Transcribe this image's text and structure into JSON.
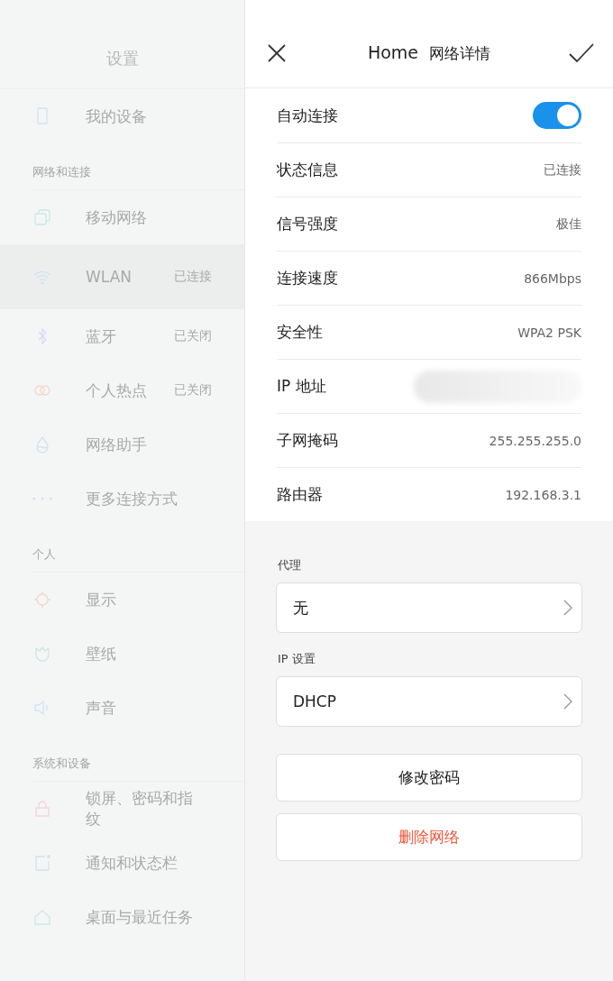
{
  "sidebar": {
    "title": "设置",
    "sections": [
      {
        "items": [
          {
            "label": "我的设备",
            "selected": false
          }
        ]
      },
      {
        "heading": "网络和连接",
        "items": [
          {
            "label": "移动网络",
            "selected": false
          },
          {
            "label": "WLAN",
            "status": "已连接",
            "selected": true
          },
          {
            "label": "蓝牙",
            "status": "已关闭",
            "selected": false
          },
          {
            "label": "个人热点",
            "status": "已关闭",
            "selected": false
          },
          {
            "label": "网络助手",
            "selected": false
          },
          {
            "label": "更多连接方式",
            "selected": false
          }
        ]
      },
      {
        "heading": "个人",
        "items": [
          {
            "label": "显示",
            "selected": false
          },
          {
            "label": "壁纸",
            "selected": false
          },
          {
            "label": "声音",
            "selected": false
          }
        ]
      },
      {
        "heading": "系统和设备",
        "items": [
          {
            "label": "锁屏、密码和指纹",
            "selected": false
          },
          {
            "label": "通知和状态栏",
            "selected": false
          },
          {
            "label": "桌面与最近任务",
            "selected": false
          }
        ]
      }
    ]
  },
  "detail": {
    "title": "Home",
    "subtitle": "网络详情",
    "rows": [
      {
        "kind": "toggle",
        "label": "自动连接",
        "on": true
      },
      {
        "kind": "value",
        "label": "状态信息",
        "value": "已连接"
      },
      {
        "kind": "value",
        "label": "信号强度",
        "value": "极佳"
      },
      {
        "kind": "value",
        "label": "连接速度",
        "value": "866Mbps"
      },
      {
        "kind": "value",
        "label": "安全性",
        "value": "WPA2 PSK"
      },
      {
        "kind": "hidden",
        "label": "IP 地址"
      },
      {
        "kind": "value",
        "label": "子网掩码",
        "value": "255.255.255.0"
      },
      {
        "kind": "value",
        "label": "路由器",
        "value": "192.168.3.1"
      }
    ],
    "selects": [
      {
        "label": "代理",
        "value": "无"
      },
      {
        "label": "IP 设置",
        "value": "DHCP"
      }
    ],
    "buttons": [
      {
        "kind": "normal",
        "label": "修改密码"
      },
      {
        "kind": "danger",
        "label": "删除网络"
      }
    ]
  }
}
